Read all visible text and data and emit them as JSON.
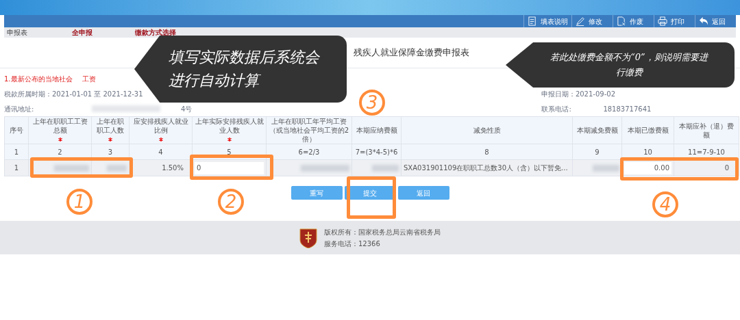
{
  "toolbar": [
    "填表说明",
    "修改",
    "作废",
    "打印",
    "返回"
  ],
  "steps": [
    {
      "label": "申报表",
      "current": false
    },
    {
      "label": "全申报",
      "current": true
    },
    {
      "label": "缴款方式选择",
      "current": true
    }
  ],
  "form_title": "残疾人就业保障金缴费申报表",
  "notice": [
    "1.最新公布的当地社会",
    "工资"
  ],
  "period": "税款所属时期：2021-01-01 至 2021-12-31",
  "declare_date": "申报日期：2021-09-02",
  "address_label": "通讯地址:",
  "address_tail": "4号",
  "phone_label": "联系电话:",
  "phone": "18183717641",
  "table": {
    "columns": [
      {
        "label": "序号",
        "required": false
      },
      {
        "label": "上年在职职工工资总额",
        "required": true
      },
      {
        "label": "上年在职职工人数",
        "required": true
      },
      {
        "label": "应安排残疾人就业比例",
        "required": true
      },
      {
        "label": "上年实际安排残疾人就业人数",
        "required": true
      },
      {
        "label": "上年在职职工年平均工资（或当地社会平均工资的2倍）",
        "required": false
      },
      {
        "label": "本期应纳费额",
        "required": false
      },
      {
        "label": "减免性质",
        "required": false
      },
      {
        "label": "本期减免费额",
        "required": false
      },
      {
        "label": "本期已缴费额",
        "required": false
      },
      {
        "label": "本期应补（退）费额",
        "required": false
      }
    ],
    "index_row": [
      "1",
      "2",
      "3",
      "4",
      "5",
      "6=2/3",
      "7=(3*4-5)*6",
      "8",
      "9",
      "10",
      "11=7-9-10"
    ],
    "rows": [
      [
        {
          "kind": "text",
          "value": "1"
        },
        {
          "kind": "blurred"
        },
        {
          "kind": "blurred"
        },
        {
          "kind": "text",
          "value": "1.50%"
        },
        {
          "kind": "input",
          "value": "0"
        },
        {
          "kind": "blurred"
        },
        {
          "kind": "blurred"
        },
        {
          "kind": "text",
          "value": "SXA031901109在职职工总数30人（含）以下暂免..."
        },
        {
          "kind": "blurred"
        },
        {
          "kind": "input",
          "value": "0.00"
        },
        {
          "kind": "text",
          "value": "0"
        }
      ]
    ]
  },
  "buttons": [
    "重写",
    "提交",
    "返回"
  ],
  "footer": {
    "copyright": "版权所有：国家税务总局云南省税务局",
    "hotline": "服务电话：12366"
  },
  "callouts": [
    "填写实际数据后系统会进行自动计算",
    "若此处缴费金额不为“0”，则说明需要进行缴费"
  ],
  "markers": [
    "1",
    "2",
    "3",
    "4"
  ]
}
